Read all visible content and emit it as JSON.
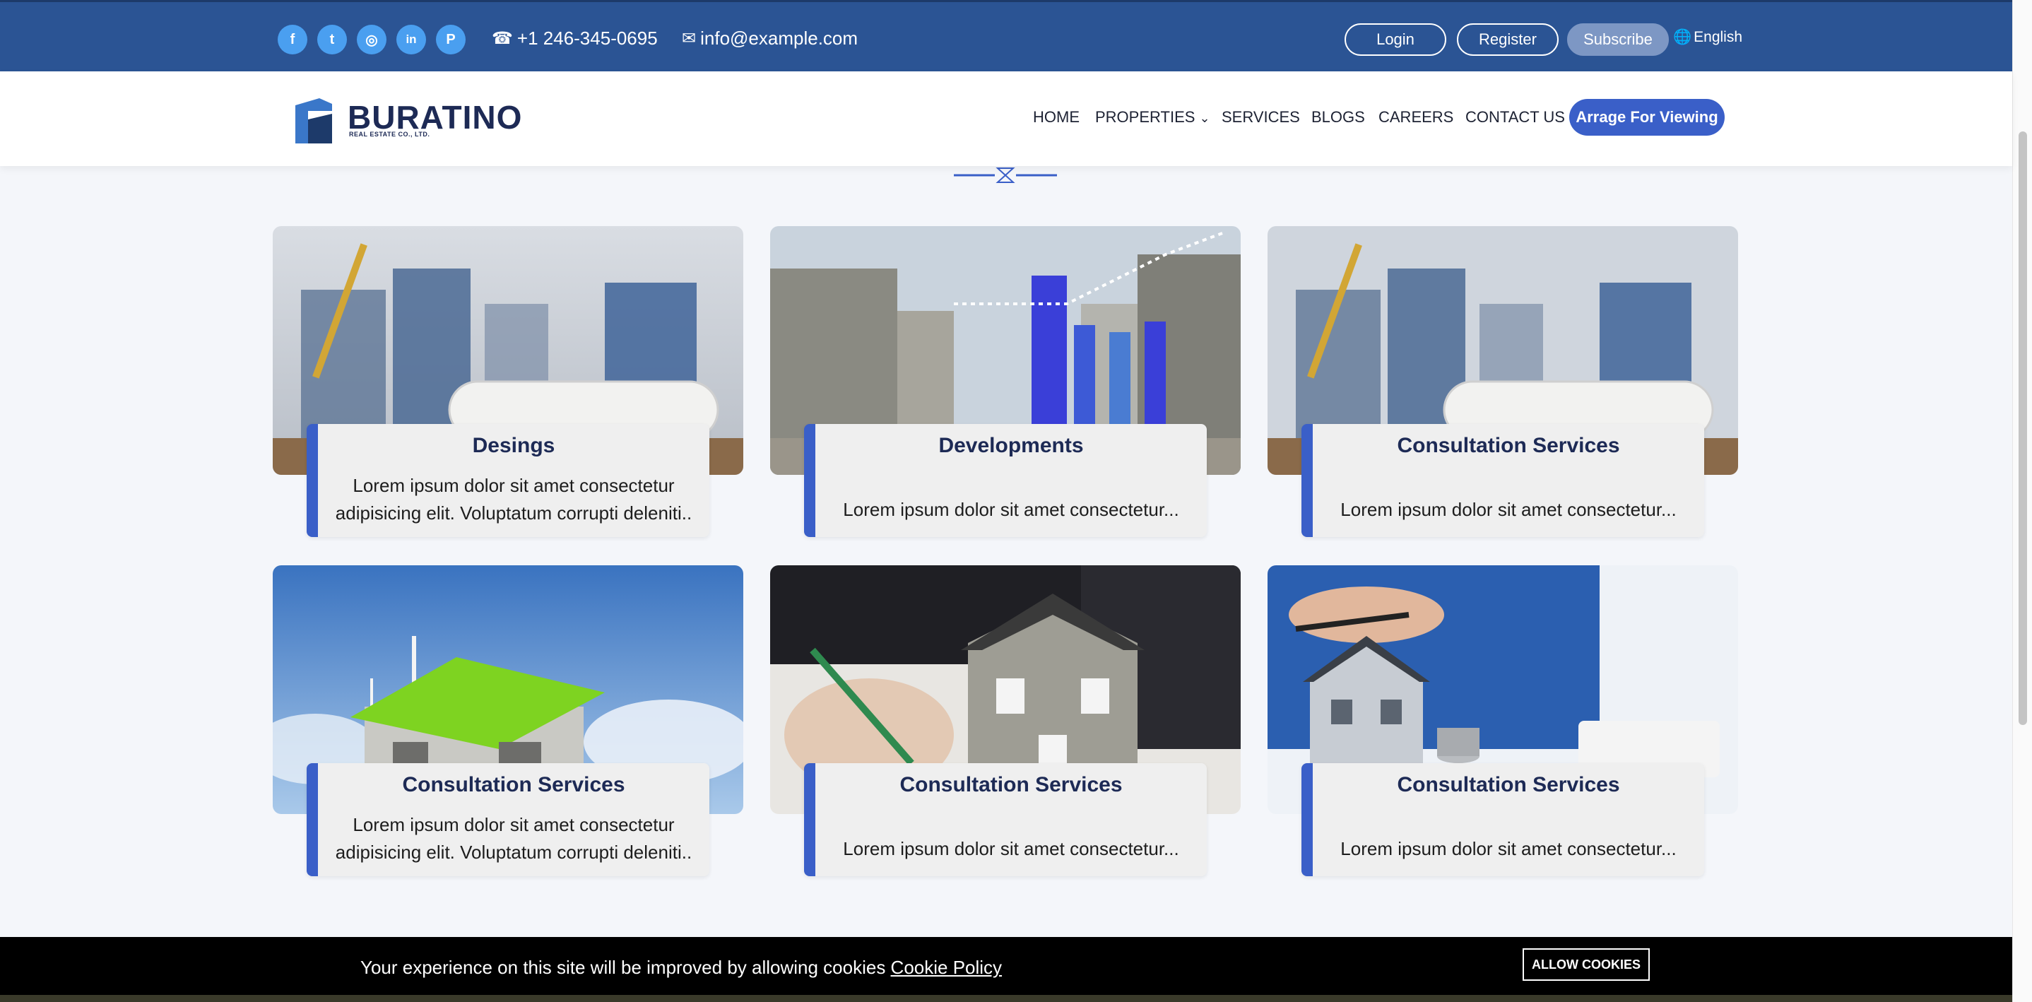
{
  "topbar": {
    "social": [
      {
        "icon": "facebook-icon",
        "glyph": "f"
      },
      {
        "icon": "twitter-icon",
        "glyph": "t"
      },
      {
        "icon": "instagram-icon",
        "glyph": "◎"
      },
      {
        "icon": "linkedin-icon",
        "glyph": "in"
      },
      {
        "icon": "pinterest-icon",
        "glyph": "P"
      }
    ],
    "phone": "+1 246-345-0695",
    "email": "info@example.com",
    "login": "Login",
    "register": "Register",
    "subscribe": "Subscribe",
    "language": "English"
  },
  "header": {
    "logo_text": "BURATINO",
    "logo_sub": "REAL ESTATE CO., LTD.",
    "nav": {
      "home": "HOME",
      "properties": "PROPERTIES",
      "services": "SERVICES",
      "blogs": "BLOGS",
      "careers": "CAREERS",
      "contact": "CONTACT US"
    },
    "cta": "Arrage For Viewing"
  },
  "cards": [
    {
      "title": "Desings",
      "desc": "Lorem ipsum dolor sit amet consectetur adipisicing elit. Voluptatum corrupti deleniti.."
    },
    {
      "title": "Developments",
      "desc": "Lorem ipsum dolor sit amet consectetur..."
    },
    {
      "title": "Consultation Services",
      "desc": "Lorem ipsum dolor sit amet consectetur..."
    },
    {
      "title": "Consultation Services",
      "desc": "Lorem ipsum dolor sit amet consectetur adipisicing elit. Voluptatum corrupti deleniti.."
    },
    {
      "title": "Consultation Services",
      "desc": "Lorem ipsum dolor sit amet consectetur..."
    },
    {
      "title": "Consultation Services",
      "desc": "Lorem ipsum dolor sit amet consectetur..."
    }
  ],
  "cookie": {
    "text": "Your experience on this site will be improved by allowing cookies",
    "link": "Cookie Policy",
    "button": "ALLOW COOKIES"
  },
  "colors": {
    "topbar": "#2b5494",
    "accent": "#3a5fc8",
    "social": "#4a9ff0",
    "heading": "#1d2a55"
  }
}
